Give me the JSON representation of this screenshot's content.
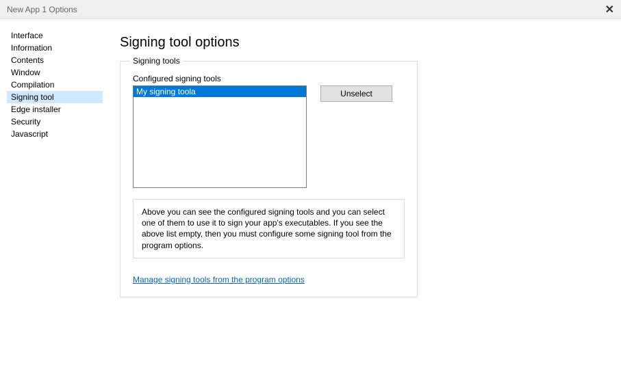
{
  "window": {
    "title": "New App 1 Options"
  },
  "sidebar": {
    "items": [
      {
        "label": "Interface",
        "selected": false
      },
      {
        "label": "Information",
        "selected": false
      },
      {
        "label": "Contents",
        "selected": false
      },
      {
        "label": "Window",
        "selected": false
      },
      {
        "label": "Compilation",
        "selected": false
      },
      {
        "label": "Signing tool",
        "selected": true
      },
      {
        "label": "Edge installer",
        "selected": false
      },
      {
        "label": "Security",
        "selected": false
      },
      {
        "label": "Javascript",
        "selected": false
      }
    ]
  },
  "main": {
    "heading": "Signing tool options",
    "fieldset_legend": "Signing tools",
    "configured_label": "Configured signing tools",
    "listbox_items": [
      {
        "label": "My signing toola",
        "selected": true
      }
    ],
    "unselect_label": "Unselect",
    "description": "Above you can see the configured signing tools and you can select one of them to use it to sign your app's executables. If you see the above list empty, then you must configure some signing tool from the program options.",
    "manage_link": "Manage signing tools from the program options"
  }
}
